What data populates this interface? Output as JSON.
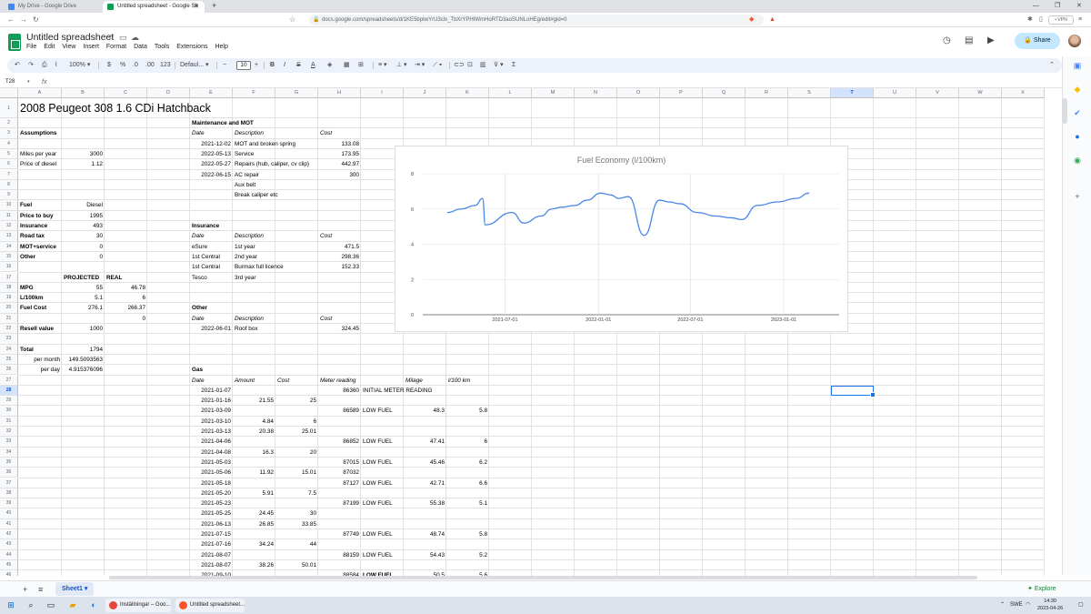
{
  "browser": {
    "tabs": [
      {
        "label": "My Drive - Google Drive",
        "color": "#4285f4"
      },
      {
        "label": "Untitled spreadsheet - Google Sh",
        "color": "#0f9d58"
      }
    ],
    "url": "docs.google.com/spreadsheets/d/1KE5bptwYrU3clx_TbXrYPHIWmHoRTD3aoSUNLoHEg/edit#gid=0",
    "vpn": "• VPN"
  },
  "sheets": {
    "doc_title": "Untitled spreadsheet",
    "menu": [
      "File",
      "Edit",
      "View",
      "Insert",
      "Format",
      "Data",
      "Tools",
      "Extensions",
      "Help"
    ],
    "share_label": "Share",
    "toolbar": {
      "zoom": "100%",
      "currency": "$",
      "percent": "%",
      "dec_less": ".0",
      "dec_more": ".00",
      "num_format": "123",
      "font": "Defaul...",
      "font_size": "10"
    },
    "name_box": "T28",
    "fx": "fx",
    "sheet_tab": "Sheet1",
    "explore": "Explore"
  },
  "grid": {
    "columns": [
      "A",
      "B",
      "C",
      "D",
      "E",
      "F",
      "G",
      "H",
      "I",
      "J",
      "K",
      "L",
      "M",
      "N",
      "O",
      "P",
      "Q",
      "R",
      "S",
      "T",
      "U",
      "V",
      "W",
      "X"
    ],
    "selected_column": "T",
    "selected_row": 28,
    "first_row": 1,
    "last_row": 46,
    "cells": [
      {
        "c": "A",
        "r": 1,
        "t": "2008 Peugeot 308 1.6 CDi Hatchback",
        "s": "big"
      },
      {
        "c": "E",
        "r": 2,
        "t": "Maintenance and MOT",
        "s": "b"
      },
      {
        "c": "A",
        "r": 3,
        "t": "Assumptions",
        "s": "b"
      },
      {
        "c": "E",
        "r": 3,
        "t": "Date",
        "s": "i"
      },
      {
        "c": "F",
        "r": 3,
        "t": "Description",
        "s": "i"
      },
      {
        "c": "H",
        "r": 3,
        "t": "Cost",
        "s": "i"
      },
      {
        "c": "E",
        "r": 4,
        "t": "2021-12-02",
        "s": "r"
      },
      {
        "c": "F",
        "r": 4,
        "t": "MOT and broken spring"
      },
      {
        "c": "H",
        "r": 4,
        "t": "133.08",
        "s": "r"
      },
      {
        "c": "A",
        "r": 5,
        "t": "Miles per year"
      },
      {
        "c": "B",
        "r": 5,
        "t": "3000",
        "s": "r"
      },
      {
        "c": "E",
        "r": 5,
        "t": "2022-05-13",
        "s": "r"
      },
      {
        "c": "F",
        "r": 5,
        "t": "Service"
      },
      {
        "c": "H",
        "r": 5,
        "t": "173.95",
        "s": "r"
      },
      {
        "c": "A",
        "r": 6,
        "t": "Price of diesel"
      },
      {
        "c": "B",
        "r": 6,
        "t": "1.12",
        "s": "r"
      },
      {
        "c": "E",
        "r": 6,
        "t": "2022-05-27",
        "s": "r"
      },
      {
        "c": "F",
        "r": 6,
        "t": "Repairs (hub, caliper, cv clip)"
      },
      {
        "c": "H",
        "r": 6,
        "t": "442.97",
        "s": "r"
      },
      {
        "c": "E",
        "r": 7,
        "t": "2022-06-15",
        "s": "r"
      },
      {
        "c": "F",
        "r": 7,
        "t": "AC repair"
      },
      {
        "c": "H",
        "r": 7,
        "t": "300",
        "s": "r"
      },
      {
        "c": "F",
        "r": 8,
        "t": "Aux belt"
      },
      {
        "c": "F",
        "r": 9,
        "t": "Break caliper etc"
      },
      {
        "c": "A",
        "r": 10,
        "t": "Fuel",
        "s": "b"
      },
      {
        "c": "B",
        "r": 10,
        "t": "Diesel",
        "s": "r"
      },
      {
        "c": "A",
        "r": 11,
        "t": "Price to buy",
        "s": "b"
      },
      {
        "c": "B",
        "r": 11,
        "t": "1995",
        "s": "r"
      },
      {
        "c": "A",
        "r": 12,
        "t": "Insurance",
        "s": "b"
      },
      {
        "c": "B",
        "r": 12,
        "t": "493",
        "s": "r"
      },
      {
        "c": "E",
        "r": 12,
        "t": "Insurance",
        "s": "b"
      },
      {
        "c": "A",
        "r": 13,
        "t": "Road tax",
        "s": "b"
      },
      {
        "c": "B",
        "r": 13,
        "t": "30",
        "s": "r"
      },
      {
        "c": "E",
        "r": 13,
        "t": "Date",
        "s": "i"
      },
      {
        "c": "F",
        "r": 13,
        "t": "Description",
        "s": "i"
      },
      {
        "c": "H",
        "r": 13,
        "t": "Cost",
        "s": "i"
      },
      {
        "c": "A",
        "r": 14,
        "t": "MOT+service",
        "s": "b"
      },
      {
        "c": "B",
        "r": 14,
        "t": "0",
        "s": "r"
      },
      {
        "c": "E",
        "r": 14,
        "t": "eSure"
      },
      {
        "c": "F",
        "r": 14,
        "t": "1st year"
      },
      {
        "c": "H",
        "r": 14,
        "t": "471.5",
        "s": "r"
      },
      {
        "c": "A",
        "r": 15,
        "t": "Other",
        "s": "b"
      },
      {
        "c": "B",
        "r": 15,
        "t": "0",
        "s": "r"
      },
      {
        "c": "E",
        "r": 15,
        "t": "1st Central"
      },
      {
        "c": "F",
        "r": 15,
        "t": "2nd year"
      },
      {
        "c": "H",
        "r": 15,
        "t": "298.36",
        "s": "r"
      },
      {
        "c": "E",
        "r": 16,
        "t": "1st Central"
      },
      {
        "c": "F",
        "r": 16,
        "t": "Burmax full licence"
      },
      {
        "c": "H",
        "r": 16,
        "t": "152.33",
        "s": "r"
      },
      {
        "c": "B",
        "r": 17,
        "t": "PROJECTED",
        "s": "b"
      },
      {
        "c": "C",
        "r": 17,
        "t": "REAL",
        "s": "b"
      },
      {
        "c": "E",
        "r": 17,
        "t": "Tesco"
      },
      {
        "c": "F",
        "r": 17,
        "t": "3rd year"
      },
      {
        "c": "A",
        "r": 18,
        "t": "MPG",
        "s": "b"
      },
      {
        "c": "B",
        "r": 18,
        "t": "55",
        "s": "r"
      },
      {
        "c": "C",
        "r": 18,
        "t": "46.78",
        "s": "r"
      },
      {
        "c": "A",
        "r": 19,
        "t": "L/100km",
        "s": "b"
      },
      {
        "c": "B",
        "r": 19,
        "t": "5.1",
        "s": "r"
      },
      {
        "c": "C",
        "r": 19,
        "t": "6",
        "s": "r"
      },
      {
        "c": "A",
        "r": 20,
        "t": "Fuel Cost",
        "s": "b"
      },
      {
        "c": "B",
        "r": 20,
        "t": "276.1",
        "s": "r"
      },
      {
        "c": "C",
        "r": 20,
        "t": "266.37",
        "s": "r"
      },
      {
        "c": "E",
        "r": 20,
        "t": "Other",
        "s": "b"
      },
      {
        "c": "C",
        "r": 21,
        "t": "0",
        "s": "r"
      },
      {
        "c": "E",
        "r": 21,
        "t": "Date",
        "s": "i"
      },
      {
        "c": "F",
        "r": 21,
        "t": "Description",
        "s": "i"
      },
      {
        "c": "H",
        "r": 21,
        "t": "Cost",
        "s": "i"
      },
      {
        "c": "A",
        "r": 22,
        "t": "Resell value",
        "s": "b"
      },
      {
        "c": "B",
        "r": 22,
        "t": "1000",
        "s": "r"
      },
      {
        "c": "E",
        "r": 22,
        "t": "2022-06-01",
        "s": "r"
      },
      {
        "c": "F",
        "r": 22,
        "t": "Roof box"
      },
      {
        "c": "H",
        "r": 22,
        "t": "324.45",
        "s": "r"
      },
      {
        "c": "A",
        "r": 24,
        "t": "Total",
        "s": "b"
      },
      {
        "c": "B",
        "r": 24,
        "t": "1794",
        "s": "r"
      },
      {
        "c": "A",
        "r": 25,
        "t": "per month",
        "s": "r"
      },
      {
        "c": "B",
        "r": 25,
        "t": "149.5093563",
        "s": "r"
      },
      {
        "c": "A",
        "r": 26,
        "t": "per day",
        "s": "r"
      },
      {
        "c": "B",
        "r": 26,
        "t": "4.915376096",
        "s": "r"
      },
      {
        "c": "E",
        "r": 26,
        "t": "Gas",
        "s": "b"
      },
      {
        "c": "E",
        "r": 27,
        "t": "Date",
        "s": "i"
      },
      {
        "c": "F",
        "r": 27,
        "t": "Amount",
        "s": "i"
      },
      {
        "c": "G",
        "r": 27,
        "t": "Cost",
        "s": "i"
      },
      {
        "c": "H",
        "r": 27,
        "t": "Meter reading",
        "s": "i"
      },
      {
        "c": "J",
        "r": 27,
        "t": "Milage",
        "s": "i"
      },
      {
        "c": "K",
        "r": 27,
        "t": "l/100 km",
        "s": "i"
      },
      {
        "c": "E",
        "r": 28,
        "t": "2021-01-07",
        "s": "r"
      },
      {
        "c": "H",
        "r": 28,
        "t": "86360",
        "s": "r"
      },
      {
        "c": "I",
        "r": 28,
        "t": "INITIAL METER READING"
      },
      {
        "c": "E",
        "r": 29,
        "t": "2021-01-16",
        "s": "r"
      },
      {
        "c": "F",
        "r": 29,
        "t": "21.55",
        "s": "r"
      },
      {
        "c": "G",
        "r": 29,
        "t": "25",
        "s": "r"
      },
      {
        "c": "E",
        "r": 30,
        "t": "2021-03-09",
        "s": "r"
      },
      {
        "c": "H",
        "r": 30,
        "t": "86589",
        "s": "r"
      },
      {
        "c": "I",
        "r": 30,
        "t": "LOW FUEL"
      },
      {
        "c": "J",
        "r": 30,
        "t": "48.3",
        "s": "r"
      },
      {
        "c": "K",
        "r": 30,
        "t": "5.8",
        "s": "r"
      },
      {
        "c": "E",
        "r": 31,
        "t": "2021-03-10",
        "s": "r"
      },
      {
        "c": "F",
        "r": 31,
        "t": "4.84",
        "s": "r"
      },
      {
        "c": "G",
        "r": 31,
        "t": "6",
        "s": "r"
      },
      {
        "c": "E",
        "r": 32,
        "t": "2021-03-13",
        "s": "r"
      },
      {
        "c": "F",
        "r": 32,
        "t": "20.38",
        "s": "r"
      },
      {
        "c": "G",
        "r": 32,
        "t": "25.01",
        "s": "r"
      },
      {
        "c": "E",
        "r": 33,
        "t": "2021-04-06",
        "s": "r"
      },
      {
        "c": "H",
        "r": 33,
        "t": "86852",
        "s": "r"
      },
      {
        "c": "I",
        "r": 33,
        "t": "LOW FUEL"
      },
      {
        "c": "J",
        "r": 33,
        "t": "47.41",
        "s": "r"
      },
      {
        "c": "K",
        "r": 33,
        "t": "6",
        "s": "r"
      },
      {
        "c": "E",
        "r": 34,
        "t": "2021-04-08",
        "s": "r"
      },
      {
        "c": "F",
        "r": 34,
        "t": "16.3",
        "s": "r"
      },
      {
        "c": "G",
        "r": 34,
        "t": "20",
        "s": "r"
      },
      {
        "c": "E",
        "r": 35,
        "t": "2021-05-03",
        "s": "r"
      },
      {
        "c": "H",
        "r": 35,
        "t": "87015",
        "s": "r"
      },
      {
        "c": "I",
        "r": 35,
        "t": "LOW FUEL"
      },
      {
        "c": "J",
        "r": 35,
        "t": "45.46",
        "s": "r"
      },
      {
        "c": "K",
        "r": 35,
        "t": "6.2",
        "s": "r"
      },
      {
        "c": "E",
        "r": 36,
        "t": "2021-05-06",
        "s": "r"
      },
      {
        "c": "F",
        "r": 36,
        "t": "11.92",
        "s": "r"
      },
      {
        "c": "G",
        "r": 36,
        "t": "15.01",
        "s": "r"
      },
      {
        "c": "H",
        "r": 36,
        "t": "87032",
        "s": "r"
      },
      {
        "c": "E",
        "r": 37,
        "t": "2021-05-18",
        "s": "r"
      },
      {
        "c": "H",
        "r": 37,
        "t": "87127",
        "s": "r"
      },
      {
        "c": "I",
        "r": 37,
        "t": "LOW FUEL"
      },
      {
        "c": "J",
        "r": 37,
        "t": "42.71",
        "s": "r"
      },
      {
        "c": "K",
        "r": 37,
        "t": "6.6",
        "s": "r"
      },
      {
        "c": "E",
        "r": 38,
        "t": "2021-05-20",
        "s": "r"
      },
      {
        "c": "F",
        "r": 38,
        "t": "5.91",
        "s": "r"
      },
      {
        "c": "G",
        "r": 38,
        "t": "7.5",
        "s": "r"
      },
      {
        "c": "E",
        "r": 39,
        "t": "2021-05-23",
        "s": "r"
      },
      {
        "c": "H",
        "r": 39,
        "t": "87199",
        "s": "r"
      },
      {
        "c": "I",
        "r": 39,
        "t": "LOW FUEL"
      },
      {
        "c": "J",
        "r": 39,
        "t": "55.38",
        "s": "r"
      },
      {
        "c": "K",
        "r": 39,
        "t": "5.1",
        "s": "r"
      },
      {
        "c": "E",
        "r": 40,
        "t": "2021-05-25",
        "s": "r"
      },
      {
        "c": "F",
        "r": 40,
        "t": "24.45",
        "s": "r"
      },
      {
        "c": "G",
        "r": 40,
        "t": "30",
        "s": "r"
      },
      {
        "c": "E",
        "r": 41,
        "t": "2021-06-13",
        "s": "r"
      },
      {
        "c": "F",
        "r": 41,
        "t": "26.85",
        "s": "r"
      },
      {
        "c": "G",
        "r": 41,
        "t": "33.85",
        "s": "r"
      },
      {
        "c": "E",
        "r": 42,
        "t": "2021-07-15",
        "s": "r"
      },
      {
        "c": "H",
        "r": 42,
        "t": "87749",
        "s": "r"
      },
      {
        "c": "I",
        "r": 42,
        "t": "LOW FUEL"
      },
      {
        "c": "J",
        "r": 42,
        "t": "48.74",
        "s": "r"
      },
      {
        "c": "K",
        "r": 42,
        "t": "5.8",
        "s": "r"
      },
      {
        "c": "E",
        "r": 43,
        "t": "2021-07-16",
        "s": "r"
      },
      {
        "c": "F",
        "r": 43,
        "t": "34.24",
        "s": "r"
      },
      {
        "c": "G",
        "r": 43,
        "t": "44",
        "s": "r"
      },
      {
        "c": "E",
        "r": 44,
        "t": "2021-08-07",
        "s": "r"
      },
      {
        "c": "H",
        "r": 44,
        "t": "88159",
        "s": "r"
      },
      {
        "c": "I",
        "r": 44,
        "t": "LOW FUEL"
      },
      {
        "c": "J",
        "r": 44,
        "t": "54.43",
        "s": "r"
      },
      {
        "c": "K",
        "r": 44,
        "t": "5.2",
        "s": "r"
      },
      {
        "c": "E",
        "r": 45,
        "t": "2021-08-07",
        "s": "r"
      },
      {
        "c": "F",
        "r": 45,
        "t": "38.26",
        "s": "r"
      },
      {
        "c": "G",
        "r": 45,
        "t": "50.01",
        "s": "r"
      },
      {
        "c": "E",
        "r": 46,
        "t": "2021-09-10",
        "s": "r"
      },
      {
        "c": "H",
        "r": 46,
        "t": "88584",
        "s": "r"
      },
      {
        "c": "I",
        "r": 46,
        "t": "LOW FUEL",
        "s": "b"
      },
      {
        "c": "J",
        "r": 46,
        "t": "50.5",
        "s": "r"
      },
      {
        "c": "K",
        "r": 46,
        "t": "5.6",
        "s": "r"
      }
    ]
  },
  "chart_data": {
    "type": "line",
    "title": "Fuel Economy (l/100km)",
    "xlabel": "",
    "ylabel": "",
    "ylim": [
      0,
      8
    ],
    "yticks": [
      "0",
      "2",
      "4",
      "6",
      "8"
    ],
    "xticks": [
      "2021-07-01",
      "2022-01-01",
      "2022-07-01",
      "2023-01-01"
    ],
    "grid": true,
    "line_color": "#4a86e8",
    "series": [
      {
        "x": [
          "2021-03-09",
          "2021-04-06",
          "2021-05-03",
          "2021-05-18",
          "2021-05-23",
          "2021-07-15",
          "2021-08-07",
          "2021-09-10",
          "2021-10-01",
          "2021-10-20",
          "2021-11-15",
          "2021-12-10",
          "2022-01-05",
          "2022-01-25",
          "2022-02-10",
          "2022-03-01",
          "2022-04-01",
          "2022-05-01",
          "2022-05-20",
          "2022-06-10",
          "2022-07-15",
          "2022-08-20",
          "2022-09-20",
          "2022-10-10",
          "2022-11-10",
          "2022-12-20",
          "2023-01-25",
          "2023-02-20"
        ],
        "y": [
          5.8,
          6.0,
          6.2,
          6.6,
          5.1,
          5.8,
          5.2,
          5.6,
          6.0,
          6.1,
          6.2,
          6.5,
          6.9,
          6.8,
          6.6,
          6.7,
          4.5,
          6.5,
          6.4,
          6.3,
          5.8,
          5.6,
          5.5,
          5.4,
          6.2,
          6.4,
          6.6,
          6.9
        ]
      }
    ]
  },
  "taskbar": {
    "apps": [
      {
        "label": "Inställningar – Goo...",
        "color": "#e8453c"
      },
      {
        "label": "Untitled spreadsheet...",
        "color": "#fb542b"
      }
    ],
    "lang": "SWE",
    "time": "14:30",
    "date": "2023-04-26"
  }
}
